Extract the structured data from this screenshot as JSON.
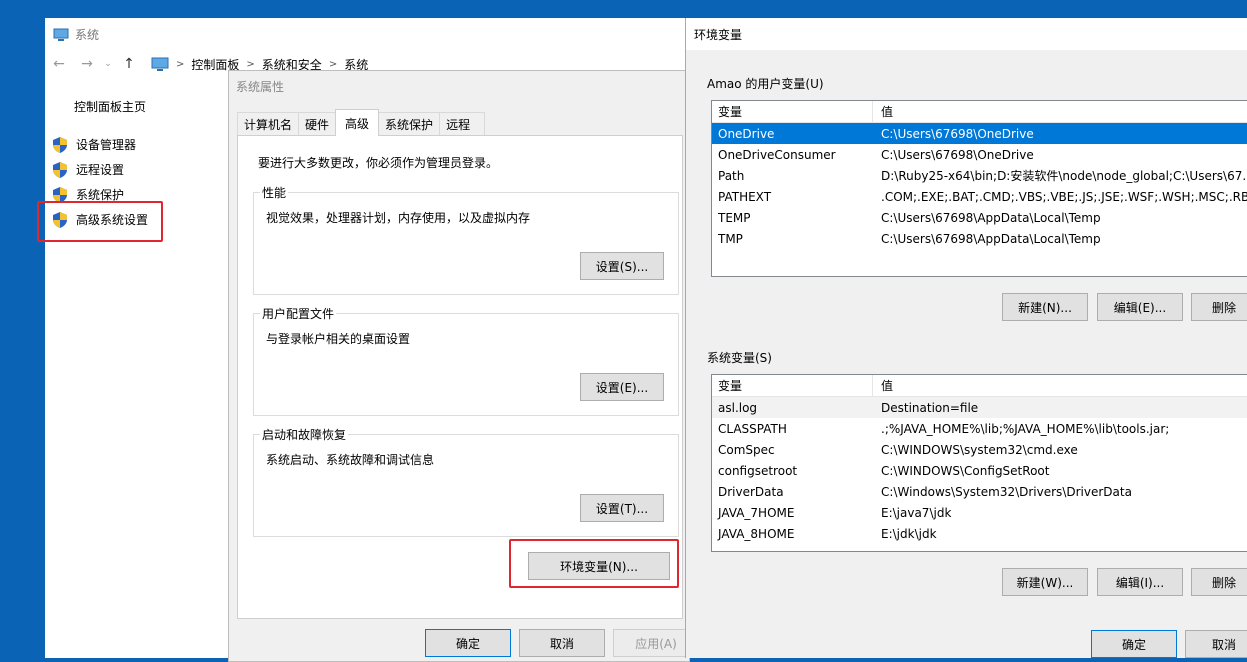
{
  "system_window": {
    "title": "系统",
    "breadcrumb": [
      "控制面板",
      "系统和安全",
      "系统"
    ],
    "sidebar_home": "控制面板主页",
    "links": [
      "设备管理器",
      "远程设置",
      "系统保护",
      "高级系统设置"
    ]
  },
  "system_properties": {
    "title": "系统属性",
    "tabs": [
      "计算机名",
      "硬件",
      "高级",
      "系统保护",
      "远程"
    ],
    "active_tab": "高级",
    "admin_note": "要进行大多数更改，你必须作为管理员登录。",
    "groups": [
      {
        "legend": "性能",
        "desc": "视觉效果，处理器计划，内存使用，以及虚拟内存",
        "button": "设置(S)..."
      },
      {
        "legend": "用户配置文件",
        "desc": "与登录帐户相关的桌面设置",
        "button": "设置(E)..."
      },
      {
        "legend": "启动和故障恢复",
        "desc": "系统启动、系统故障和调试信息",
        "button": "设置(T)..."
      }
    ],
    "env_button": "环境变量(N)...",
    "footer": {
      "ok": "确定",
      "cancel": "取消",
      "apply": "应用(A)"
    }
  },
  "env_dialog": {
    "title": "环境变量",
    "user_section": "Amao 的用户变量(U)",
    "columns": {
      "name": "变量",
      "value": "值"
    },
    "user_vars": [
      {
        "name": "OneDrive",
        "value": "C:\\Users\\67698\\OneDrive"
      },
      {
        "name": "OneDriveConsumer",
        "value": "C:\\Users\\67698\\OneDrive"
      },
      {
        "name": "Path",
        "value": "D:\\Ruby25-x64\\bin;D:安装软件\\node\\node_global;C:\\Users\\67..."
      },
      {
        "name": "PATHEXT",
        "value": ".COM;.EXE;.BAT;.CMD;.VBS;.VBE;.JS;.JSE;.WSF;.WSH;.MSC;.RB;...."
      },
      {
        "name": "TEMP",
        "value": "C:\\Users\\67698\\AppData\\Local\\Temp"
      },
      {
        "name": "TMP",
        "value": "C:\\Users\\67698\\AppData\\Local\\Temp"
      }
    ],
    "user_buttons": {
      "new": "新建(N)...",
      "edit": "编辑(E)...",
      "delete": "删除"
    },
    "system_section": "系统变量(S)",
    "system_vars": [
      {
        "name": "asl.log",
        "value": "Destination=file"
      },
      {
        "name": "CLASSPATH",
        "value": ".;%JAVA_HOME%\\lib;%JAVA_HOME%\\lib\\tools.jar;"
      },
      {
        "name": "ComSpec",
        "value": "C:\\WINDOWS\\system32\\cmd.exe"
      },
      {
        "name": "configsetroot",
        "value": "C:\\WINDOWS\\ConfigSetRoot"
      },
      {
        "name": "DriverData",
        "value": "C:\\Windows\\System32\\Drivers\\DriverData"
      },
      {
        "name": "JAVA_7HOME",
        "value": "E:\\java7\\jdk"
      },
      {
        "name": "JAVA_8HOME",
        "value": "E:\\jdk\\jdk"
      }
    ],
    "system_buttons": {
      "new": "新建(W)...",
      "edit": "编辑(I)...",
      "delete": "删除"
    },
    "footer": {
      "ok": "确定",
      "cancel": "取消"
    }
  },
  "colors": {
    "desktop": "#0b63b5",
    "selection": "#0078d7",
    "highlight_box": "#e0262e"
  }
}
